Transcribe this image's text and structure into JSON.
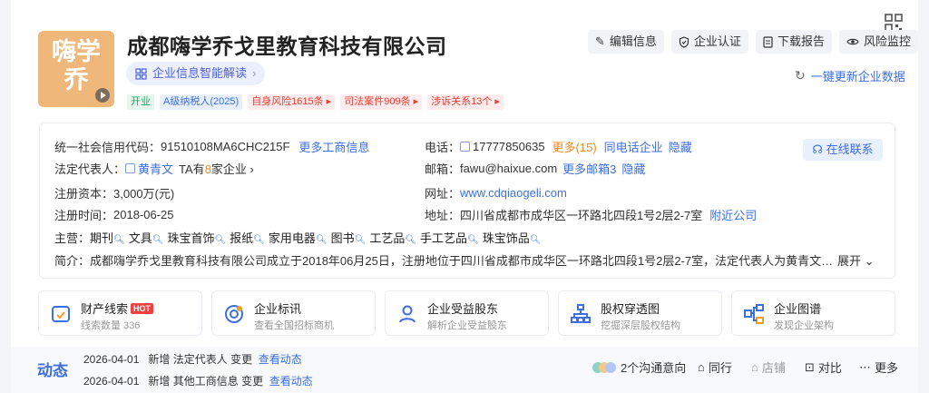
{
  "company": {
    "name": "成都嗨学乔戈里教育科技有限公司",
    "logo_lines": [
      "嗨学",
      "乔"
    ],
    "ai_pill": "企业信息智能解读",
    "tags": [
      {
        "label": "开业",
        "style": "green"
      },
      {
        "label": "A级纳税人(2025)",
        "style": "blue"
      },
      {
        "label": "自身风险1615条 ▸",
        "style": "red"
      },
      {
        "label": "司法案件909条 ▸",
        "style": "red"
      },
      {
        "label": "涉诉关系13个 ▸",
        "style": "red"
      }
    ]
  },
  "actions": [
    {
      "label": "编辑信息",
      "icon": "edit-icon"
    },
    {
      "label": "企业认证",
      "icon": "shield-icon"
    },
    {
      "label": "下载报告",
      "icon": "document-icon"
    },
    {
      "label": "风险监控",
      "icon": "eye-icon"
    }
  ],
  "refresh_label": "一键更新企业数据",
  "info": {
    "credit_code_label": "统一社会信用代码：",
    "credit_code": "91510108MA6CHC215F",
    "more_business": "更多工商信息",
    "legal_rep_label": "法定代表人：",
    "legal_rep": "黄青文",
    "ta_prefix": "TA有",
    "ta_count": "8",
    "ta_suffix": "家企业 ›",
    "capital_label": "注册资本：",
    "capital": "3,000万(元)",
    "reg_date_label": "注册时间：",
    "reg_date": "2018-06-25",
    "phone_label": "电话：",
    "phone": "17777850635",
    "phone_more": "更多(15)",
    "same_phone": "同电话企业",
    "hide": "隐藏",
    "email_label": "邮箱：",
    "email": "fawu@haixue.com",
    "email_more": "更多邮箱3",
    "website_label": "网址：",
    "website": "www.cdqiaogeli.com",
    "address_label": "地址：",
    "address": "四川省成都市成华区一环路北四段1号2层2-7室",
    "nearby": "附近公司",
    "service_btn": "在线联系",
    "business_label": "主营：",
    "business_items": [
      "期刊",
      "文具",
      "珠宝首饰",
      "报纸",
      "家用电器",
      "图书",
      "工艺品",
      "手工艺品",
      "珠宝饰品"
    ],
    "intro_label": "简介：",
    "intro": "成都嗨学乔戈里教育科技有限公司成立于2018年06月25日，注册地位于四川省成都市成华区一环路北四段1号2层2-7室，法定代表人为黄青文。经营范围包括-…",
    "expand": "展开 ⌄"
  },
  "features": [
    {
      "title": "财产线索",
      "hot": "HOT",
      "sub": "线索数量 336",
      "icon": "property-clue-icon",
      "color": "#3d6fe0"
    },
    {
      "title": "企业标讯",
      "hot": "",
      "sub": "查看全国招标商机",
      "icon": "bid-info-icon",
      "color": "#3d6fe0"
    },
    {
      "title": "企业受益股东",
      "hot": "",
      "sub": "解析企业受益股东",
      "icon": "beneficiary-icon",
      "color": "#3d6fe0"
    },
    {
      "title": "股权穿透图",
      "hot": "",
      "sub": "挖掘深层股权结构",
      "icon": "equity-chart-icon",
      "color": "#3d6fe0"
    },
    {
      "title": "企业图谱",
      "hot": "",
      "sub": "发现企业架构",
      "icon": "enterprise-graph-icon",
      "color": "#3d6fe0"
    }
  ],
  "bottom": {
    "title": "动态",
    "items": [
      {
        "date": "2026-04-01",
        "text": "新增 法定代表人 变更",
        "link": "查看动态"
      },
      {
        "date": "2026-04-01",
        "text": "新增 其他工商信息 变更",
        "link": "查看动态"
      }
    ],
    "contact_intent": "2个沟通意向",
    "peer": "同行",
    "shop": "店铺",
    "compare": "对比",
    "more": "更多"
  }
}
